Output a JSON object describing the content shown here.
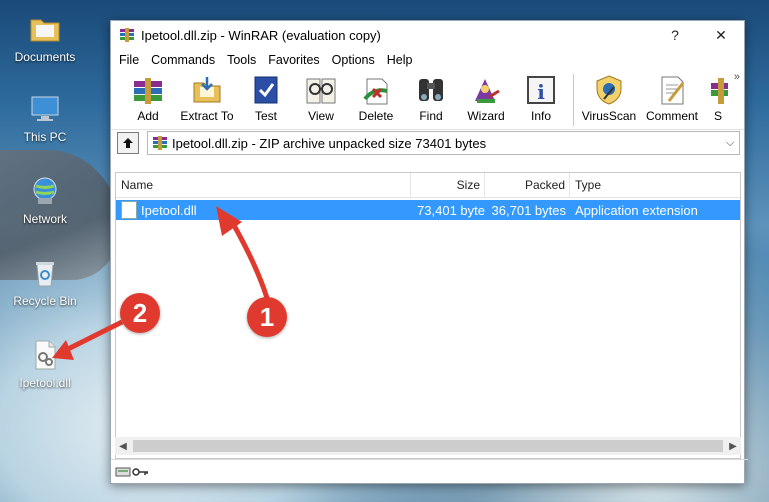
{
  "desktop": {
    "icons": [
      {
        "label": "Documents"
      },
      {
        "label": "This PC"
      },
      {
        "label": "Network"
      },
      {
        "label": "Recycle Bin"
      },
      {
        "label": "Ipetool.dll"
      }
    ]
  },
  "window": {
    "title": "Ipetool.dll.zip - WinRAR (evaluation copy)",
    "help_glyph": "?",
    "close_glyph": "✕"
  },
  "menu": [
    "File",
    "Commands",
    "Tools",
    "Favorites",
    "Options",
    "Help"
  ],
  "toolbar": {
    "buttons": [
      {
        "label": "Add",
        "icon": "add-archive-icon"
      },
      {
        "label": "Extract To",
        "icon": "extract-icon"
      },
      {
        "label": "Test",
        "icon": "test-icon"
      },
      {
        "label": "View",
        "icon": "view-icon"
      },
      {
        "label": "Delete",
        "icon": "delete-icon"
      },
      {
        "label": "Find",
        "icon": "find-icon"
      },
      {
        "label": "Wizard",
        "icon": "wizard-icon"
      },
      {
        "label": "Info",
        "icon": "info-icon"
      },
      {
        "label": "VirusScan",
        "icon": "virusscan-icon"
      },
      {
        "label": "Comment",
        "icon": "comment-icon"
      },
      {
        "label": "S",
        "icon": "sfx-icon"
      }
    ],
    "overflow_glyph": "»"
  },
  "address": {
    "text": "Ipetool.dll.zip - ZIP archive unpacked size 73401 bytes",
    "dropdown_glyph": "⌵"
  },
  "columns": {
    "name": "Name",
    "size": "Size",
    "packed": "Packed",
    "type": "Type"
  },
  "rows": [
    {
      "name": "Ipetool.dll",
      "size": "73,401 byte",
      "packed": "36,701 bytes",
      "type": "Application extension",
      "selected": true
    }
  ],
  "annotations": {
    "marker1": "1",
    "marker2": "2"
  },
  "colors": {
    "selection": "#3399ff",
    "marker": "#e03a2f"
  }
}
